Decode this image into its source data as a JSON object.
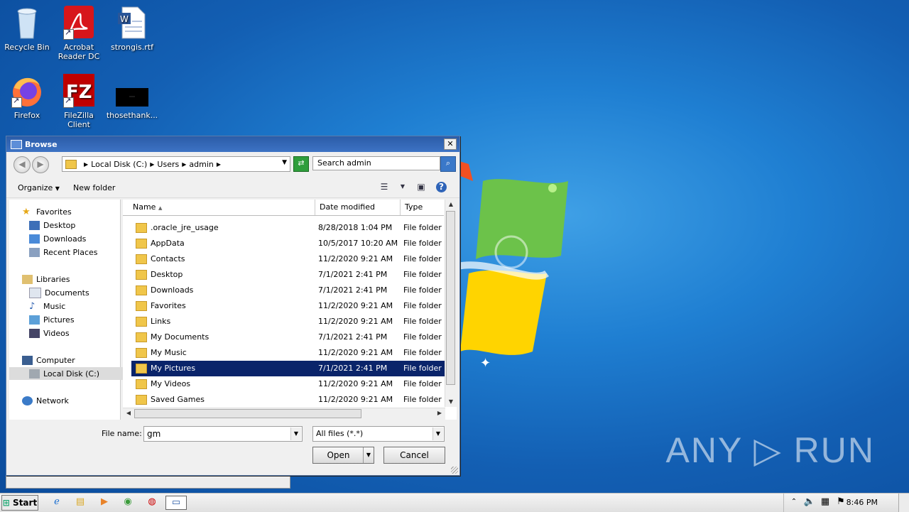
{
  "desktop": {
    "icons": [
      {
        "label": "Recycle Bin"
      },
      {
        "label": "Acrobat Reader DC"
      },
      {
        "label": "strongis.rtf"
      },
      {
        "label": "Firefox"
      },
      {
        "label": "FileZilla Client"
      },
      {
        "label": "thosethank..."
      }
    ],
    "watermark": "ANY ▷ RUN"
  },
  "dialog": {
    "title": "Browse",
    "close": "✕",
    "address": {
      "crumbs": [
        "Local Disk (C:)",
        "Users",
        "admin"
      ]
    },
    "search_placeholder": "Search admin",
    "toolbar": {
      "organize": "Organize",
      "new_folder": "New folder",
      "help": "?"
    },
    "nav": {
      "favorites": "Favorites",
      "desktop": "Desktop",
      "downloads": "Downloads",
      "recent": "Recent Places",
      "libraries": "Libraries",
      "documents": "Documents",
      "music": "Music",
      "pictures": "Pictures",
      "videos": "Videos",
      "computer": "Computer",
      "local_disk": "Local Disk (C:)",
      "network": "Network"
    },
    "columns": {
      "name": "Name",
      "date": "Date modified",
      "type": "Type"
    },
    "files": [
      {
        "name": ".oracle_jre_usage",
        "date": "8/28/2018 1:04 PM",
        "type": "File folder"
      },
      {
        "name": "AppData",
        "date": "10/5/2017 10:20 AM",
        "type": "File folder"
      },
      {
        "name": "Contacts",
        "date": "11/2/2020 9:21 AM",
        "type": "File folder"
      },
      {
        "name": "Desktop",
        "date": "7/1/2021 2:41 PM",
        "type": "File folder"
      },
      {
        "name": "Downloads",
        "date": "7/1/2021 2:41 PM",
        "type": "File folder"
      },
      {
        "name": "Favorites",
        "date": "11/2/2020 9:21 AM",
        "type": "File folder"
      },
      {
        "name": "Links",
        "date": "11/2/2020 9:21 AM",
        "type": "File folder"
      },
      {
        "name": "My Documents",
        "date": "7/1/2021 2:41 PM",
        "type": "File folder"
      },
      {
        "name": "My Music",
        "date": "11/2/2020 9:21 AM",
        "type": "File folder"
      },
      {
        "name": "My Pictures",
        "date": "7/1/2021 2:41 PM",
        "type": "File folder",
        "selected": true
      },
      {
        "name": "My Videos",
        "date": "11/2/2020 9:21 AM",
        "type": "File folder"
      },
      {
        "name": "Saved Games",
        "date": "11/2/2020 9:21 AM",
        "type": "File folder"
      }
    ],
    "file_name_label": "File name:",
    "file_name_value": "gm",
    "file_type_value": "All files (*.*)",
    "open_label": "Open",
    "cancel_label": "Cancel"
  },
  "taskbar": {
    "start_label": "Start",
    "clock": "8:46 PM"
  },
  "colors": {
    "selection": "#0a246a",
    "title_bar": "#2b5ca8",
    "desktop": "#1f7fd2"
  }
}
